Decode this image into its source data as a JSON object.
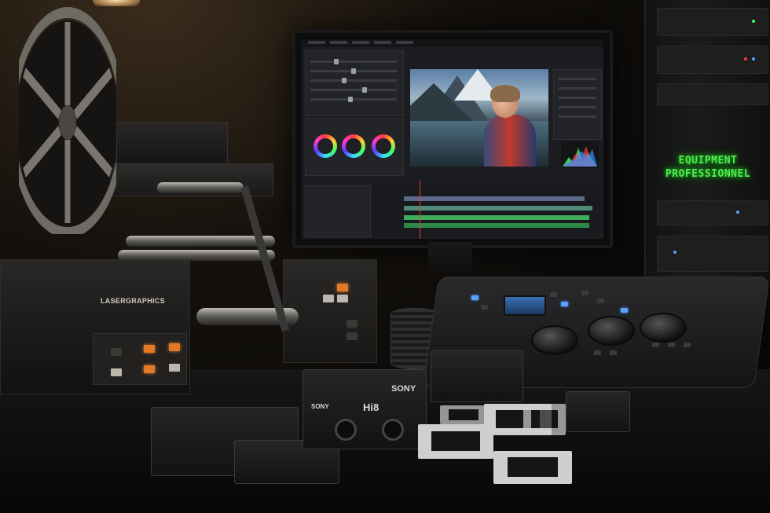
{
  "scene": {
    "description_tags": [
      "film-scanner",
      "reel",
      "color-grading-monitor",
      "control-surface",
      "video-tapes",
      "slides",
      "equipment-rack"
    ]
  },
  "scanner": {
    "brand": "LASERGRAPHICS"
  },
  "rack": {
    "sign_line1": "EQUIPMENT",
    "sign_line2": "PROFESSIONNEL"
  },
  "tapes": {
    "main_brand": "SONY",
    "main_brand_small": "SONY",
    "main_format": "Hi8"
  },
  "colors": {
    "sign_green": "#4cf04c",
    "accent_orange": "#e07a28",
    "playhead_red": "#e53935",
    "track_green": "#3fae5a"
  }
}
